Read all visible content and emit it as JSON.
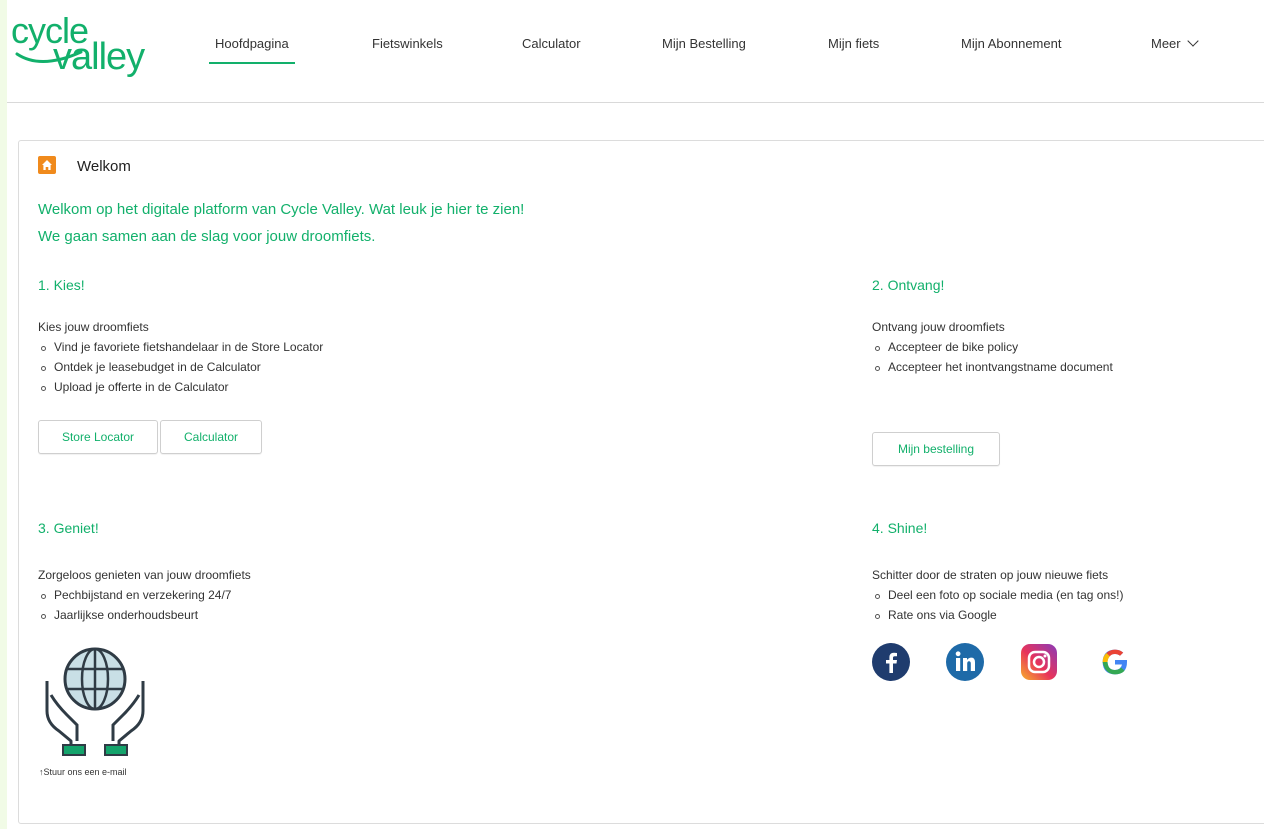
{
  "brand": {
    "logo_line1": "cycle",
    "logo_line2": "valley",
    "color": "#12b06b"
  },
  "nav": {
    "items": [
      "Hoofdpagina",
      "Fietswinkels",
      "Calculator",
      "Mijn Bestelling",
      "Mijn fiets",
      "Mijn Abonnement"
    ],
    "active": "Hoofdpagina",
    "more_label": "Meer"
  },
  "card": {
    "title": "Welkom",
    "intro_line1": "Welkom op het digitale platform van Cycle Valley. Wat leuk je hier te zien!",
    "intro_line2": "We gaan samen aan de slag voor jouw droomfiets."
  },
  "steps": {
    "kies": {
      "heading": "1. Kies!",
      "lead": "Kies jouw droomfiets",
      "bullets": [
        "Vind je favoriete fietshandelaar in de Store Locator",
        "Ontdek je leasebudget in de Calculator",
        "Upload je offerte in de Calculator"
      ],
      "button1": "Store Locator",
      "button2": "Calculator"
    },
    "ontvang": {
      "heading": "2. Ontvang!",
      "lead": "Ontvang jouw droomfiets",
      "bullets": [
        "Accepteer de bike policy",
        "Accepteer het inontvangstname document"
      ],
      "button": "Mijn bestelling"
    },
    "geniet": {
      "heading": "3. Geniet!",
      "lead": "Zorgeloos genieten van jouw droomfiets",
      "bullets": [
        "Pechbijstand en verzekering 24/7",
        "Jaarlijkse onderhoudsbeurt"
      ],
      "email_link": "↑Stuur ons een e-mail"
    },
    "shine": {
      "heading": "4. Shine!",
      "lead": "Schitter door de straten op jouw nieuwe fiets",
      "bullets": [
        "Deel een foto op sociale media (en tag ons!)",
        "Rate ons via Google"
      ]
    }
  },
  "social": [
    "facebook-icon",
    "linkedin-icon",
    "instagram-icon",
    "google-icon"
  ],
  "icons": {
    "home": "home-icon",
    "globe_hands": "globe-hands-icon",
    "nav_more": "chevron-down-icon"
  }
}
